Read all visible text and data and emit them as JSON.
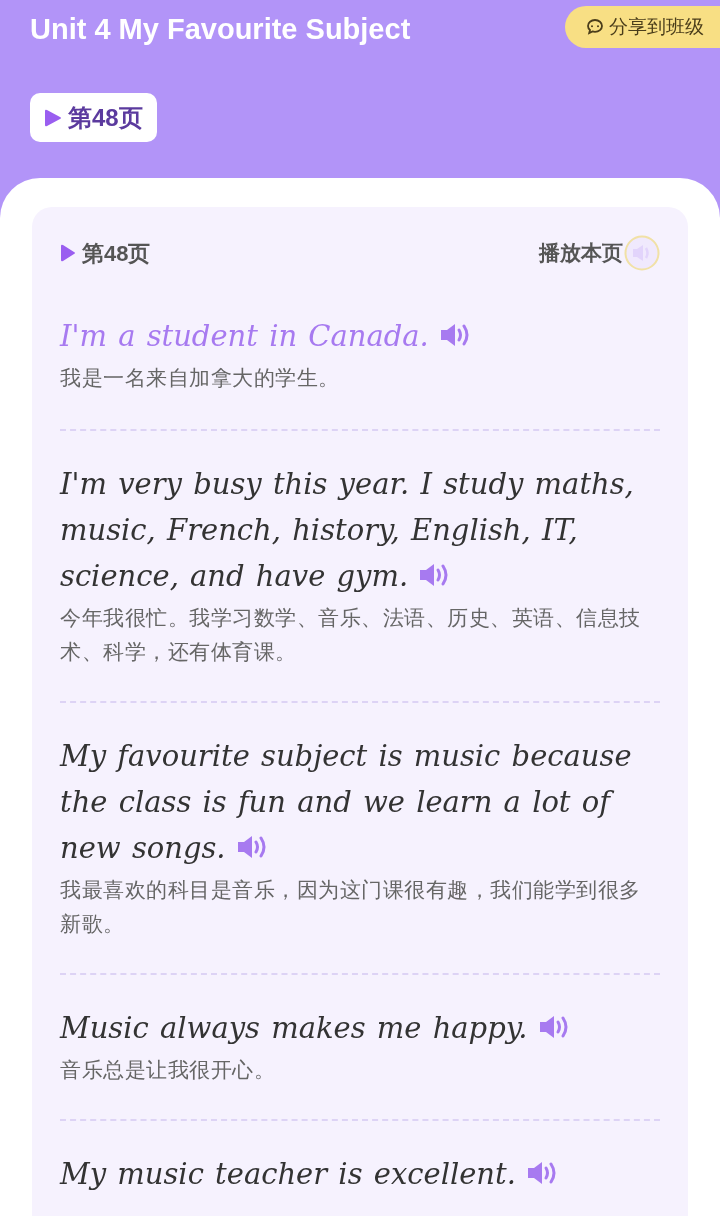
{
  "header": {
    "title": "Unit 4 My Favourite Subject",
    "share_button": "分享到班级",
    "page_badge": "第48页"
  },
  "card": {
    "page_label": "第48页",
    "play_page": "播放本页",
    "sentences": [
      {
        "text": "I'm a student in Canada.",
        "translation": "我是一名来自加拿大的学生。",
        "selected": true
      },
      {
        "text": "I'm very busy this year. I study maths, music, French, history, English, IT, science, and have gym.",
        "translation": "今年我很忙。我学习数学、音乐、法语、历史、英语、信息技术、科学，还有体育课。",
        "selected": false
      },
      {
        "text": "My favourite subject is music because the class is fun and we learn a lot of new songs.",
        "translation": "我最喜欢的科目是音乐，因为这门课很有趣，我们能学到很多新歌。",
        "selected": false
      },
      {
        "text": "Music always makes me happy.",
        "translation": "音乐总是让我很开心。",
        "selected": false
      },
      {
        "text": "My music teacher is excellent.",
        "selected": false
      }
    ]
  }
}
